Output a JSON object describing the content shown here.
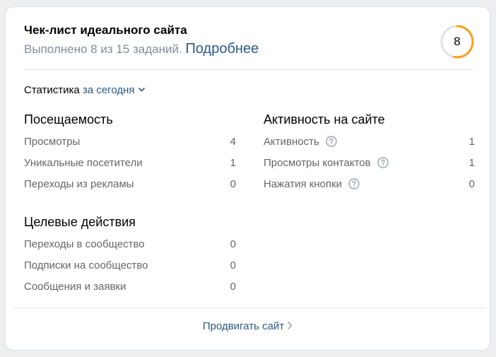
{
  "header": {
    "title": "Чек-лист идеального сайта",
    "subtitle": "Выполнено 8 из 15 заданий.",
    "more_link": "Подробнее",
    "progress_value": "8",
    "progress_fraction": 0.5333,
    "progress_color": "#ff9e1b"
  },
  "stats": {
    "label": "Статистика",
    "period": "за сегодня",
    "period_icon": "chevron-down-icon"
  },
  "attendance": {
    "title": "Посещаемость",
    "rows": [
      {
        "label": "Просмотры",
        "value": "4"
      },
      {
        "label": "Уникальные посетители",
        "value": "1"
      },
      {
        "label": "Переходы из рекламы",
        "value": "0"
      }
    ]
  },
  "activity": {
    "title": "Активность на сайте",
    "rows": [
      {
        "label": "Активность",
        "value": "1",
        "icon": "help-icon"
      },
      {
        "label": "Просмотры контактов",
        "value": "1",
        "icon": "help-icon"
      },
      {
        "label": "Нажатия кнопки",
        "value": "0",
        "icon": "help-icon"
      }
    ]
  },
  "goals": {
    "title": "Целевые действия",
    "rows": [
      {
        "label": "Переходы в сообщество",
        "value": "0"
      },
      {
        "label": "Подписки на сообщество",
        "value": "0"
      },
      {
        "label": "Сообщения и заявки",
        "value": "0"
      }
    ]
  },
  "footer": {
    "promote_label": "Продвигать сайт",
    "icon": "chevron-right-icon"
  },
  "colors": {
    "accent": "#2a5885",
    "muted": "#818c99",
    "progress": "#ff9e1b",
    "track": "#e1e3e6"
  }
}
